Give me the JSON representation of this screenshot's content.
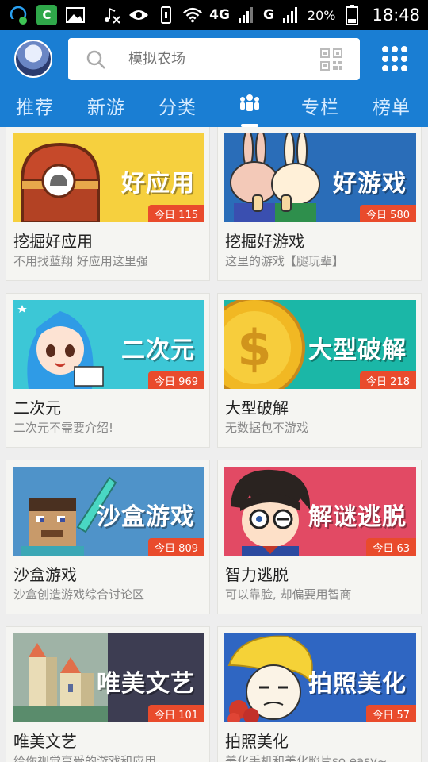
{
  "status_bar": {
    "battery_percent": "20%",
    "time": "18:48",
    "network_4g": "4G",
    "network_g": "G"
  },
  "header": {
    "search_placeholder": "模拟农场",
    "tabs": [
      "推荐",
      "新游",
      "分类",
      "专栏",
      "榜单"
    ],
    "active_tab_icon": "community-icon"
  },
  "cards": [
    {
      "banner_title": "好应用",
      "badge": "今日 115",
      "title": "挖掘好应用",
      "subtitle": "不用找蓝翔 好应用这里强",
      "color": "#f6d03e"
    },
    {
      "banner_title": "好游戏",
      "badge": "今日 580",
      "title": "挖掘好游戏",
      "subtitle": "这里的游戏【腿玩辈】",
      "color": "#2a6db8"
    },
    {
      "banner_title": "二次元",
      "badge": "今日 969",
      "title": "二次元",
      "subtitle": "二次元不需要介绍!",
      "color": "#3cc7d6"
    },
    {
      "banner_title": "大型破解",
      "badge": "今日 218",
      "title": "大型破解",
      "subtitle": "无数据包不游戏",
      "color": "#1bb7a7"
    },
    {
      "banner_title": "沙盒游戏",
      "badge": "今日 809",
      "title": "沙盒游戏",
      "subtitle": "沙盒创造游戏综合讨论区",
      "color": "#4f93c9"
    },
    {
      "banner_title": "解谜逃脱",
      "badge": "今日 63",
      "title": "智力逃脱",
      "subtitle": "可以靠脸, 却偏要用智商",
      "color": "#e24a64"
    },
    {
      "banner_title": "唯美文艺",
      "badge": "今日 101",
      "title": "唯美文艺",
      "subtitle": "给你视觉享受的游戏和应用",
      "color": "#3d3d52"
    },
    {
      "banner_title": "拍照美化",
      "badge": "今日 57",
      "title": "拍照美化",
      "subtitle": "美化手机和美化照片so easy~",
      "color": "#2f66c2"
    }
  ]
}
